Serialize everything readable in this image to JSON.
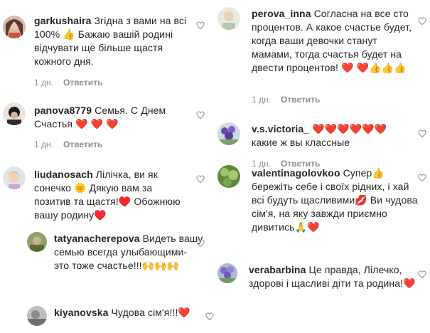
{
  "comments": [
    {
      "username": "garkushaira",
      "text": "Згідна з вами на всі 100% 👍 Бажаю вашій родині відчувати ще більше щастя кожного дня.",
      "time": "1 дн.",
      "reply": "Ответить"
    },
    {
      "username": "panova8779",
      "text": "Семья. С Днем Счастья ❤️ ❤️ ❤️",
      "time": "1 дн.",
      "reply": "Ответить"
    },
    {
      "username": "liudanosach",
      "text": "Лілічка, ви як сонечко 🌞 Дякую вам за позитив та щастя!♥️ Обожнюю вашу родину♥️",
      "time": "1 дн.",
      "reply": "Ответить"
    },
    {
      "username": "tatyanacherepova",
      "text": "Видеть вашу семью всегда улыбающими- это тоже счастье!!!🙌🙌🙌",
      "time": "",
      "reply": ""
    },
    {
      "username": "kiyanovska",
      "text": "Чудова сім'я!!!❤️",
      "time": "",
      "reply": ""
    },
    {
      "username": "perova_inna",
      "text": "Согласна на все сто процентов. А какое счастье будет, когда ваши девочки станут мамами, тогда счастья будет на двести процентов! ❤️ ❤️👍👍👍",
      "time": "1 дн.",
      "reply": "Ответить"
    },
    {
      "username": "v.s.victoria_",
      "text": "❤️❤️❤️❤️❤️❤️ какие ж вы классные",
      "time": "1 дн.",
      "reply": "Ответить"
    },
    {
      "username": "valentinagolovkoo",
      "text": "Супер👍 бережіть себе і своїх рідних, і хай всі будуть щасливими💋 Ви чудова сім'я, на яку завжди приємно дивитись🙏❤️",
      "time": "",
      "reply": ""
    },
    {
      "username": "verabarbina",
      "text": "Це правда, Лілечко, здорові і щасливі діти та родина!❤️",
      "time": "",
      "reply": ""
    }
  ],
  "colors": {
    "text": "#262626",
    "meta": "#8e8e8e",
    "heart": "#ed1c24"
  }
}
